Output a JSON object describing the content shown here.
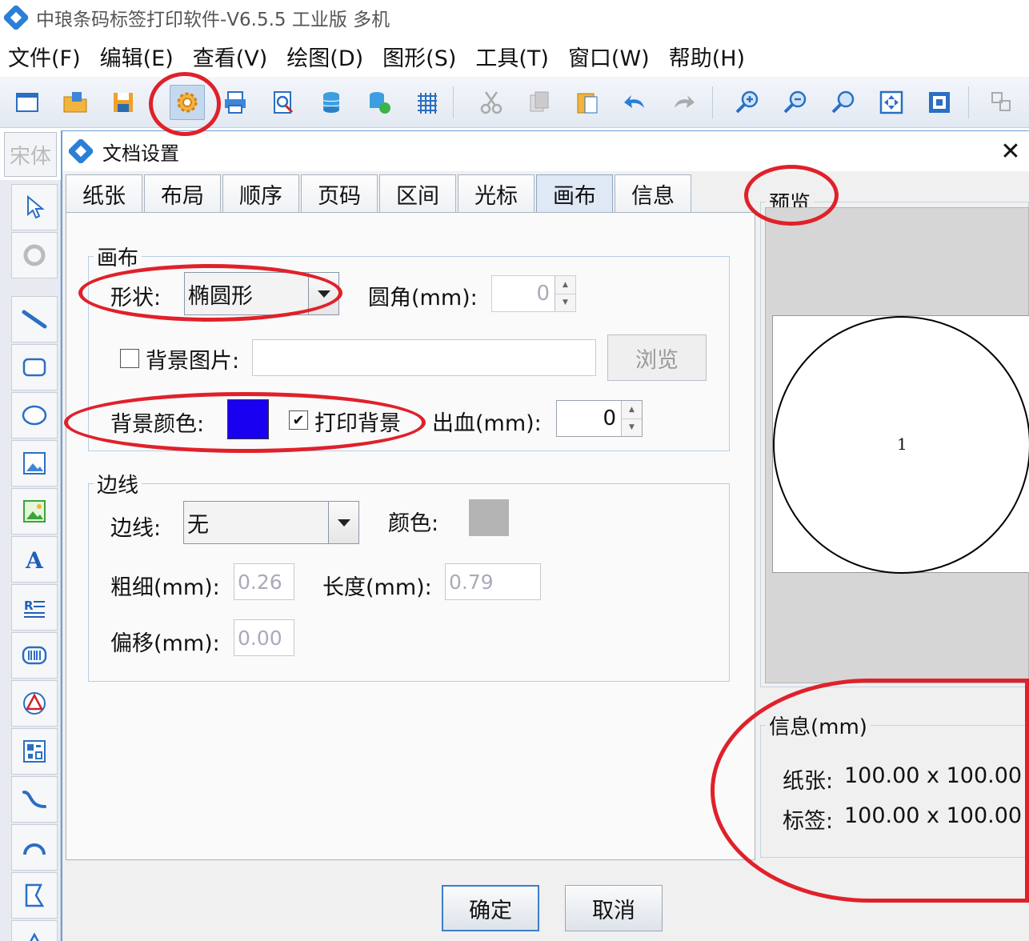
{
  "app": {
    "title": "中琅条码标签打印软件-V6.5.5 工业版 多机"
  },
  "menu": [
    "文件(F)",
    "编辑(E)",
    "查看(V)",
    "绘图(D)",
    "图形(S)",
    "工具(T)",
    "窗口(W)",
    "帮助(H)"
  ],
  "font_box": "宋体",
  "dialog": {
    "title": "文档设置",
    "close": "✕",
    "tabs": [
      "纸张",
      "布局",
      "顺序",
      "页码",
      "区间",
      "光标",
      "画布",
      "信息"
    ],
    "active_tab": "画布",
    "canvas_group": {
      "legend": "画布",
      "shape_label": "形状:",
      "shape_value": "椭圆形",
      "corner_label": "圆角(mm):",
      "corner_value": "0",
      "bg_image_label": "背景图片:",
      "bg_image_checked": false,
      "browse_button": "浏览",
      "bg_color_label": "背景颜色:",
      "bg_color": "#1a00f0",
      "print_bg_label": "打印背景",
      "print_bg_checked": true,
      "bleed_label": "出血(mm):",
      "bleed_value": "0"
    },
    "border_group": {
      "legend": "边线",
      "border_label": "边线:",
      "border_value": "无",
      "color_label": "颜色:",
      "color_swatch": "#b4b4b4",
      "thickness_label": "粗细(mm):",
      "thickness_value": "0.26",
      "length_label": "长度(mm):",
      "length_value": "0.79",
      "offset_label": "偏移(mm):",
      "offset_value": "0.00"
    },
    "preview": {
      "legend": "预览",
      "center_text": "1"
    },
    "info": {
      "legend": "信息(mm)",
      "paper_label": "纸张:",
      "paper_value": "100.00 x 100.00",
      "label_label": "标签:",
      "label_value": "100.00 x 100.00"
    },
    "ok_button": "确定",
    "cancel_button": "取消"
  },
  "colors": {
    "annotation": "#e0212a",
    "accent": "#6aa1d6"
  }
}
